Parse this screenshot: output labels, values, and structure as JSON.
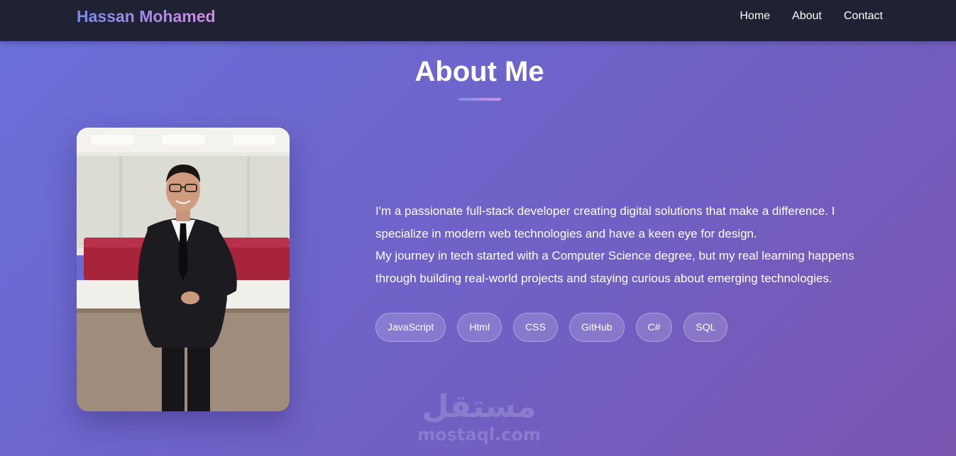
{
  "nav": {
    "brand": "Hassan Mohamed",
    "links": [
      "Home",
      "About",
      "Contact"
    ]
  },
  "about": {
    "title": "About Me",
    "bio": [
      "I'm a passionate full-stack developer creating digital solutions that make a difference. I specialize in modern web technologies and have a keen eye for design.",
      "My journey in tech started with a Computer Science degree, but my real learning happens through building real-world projects and staying curious about emerging technologies."
    ],
    "skills": [
      "JavaScript",
      "Html",
      "CSS",
      "GitHub",
      "C#",
      "SQL"
    ]
  },
  "watermark": {
    "arabic": "مستقل",
    "latin": "mostaql.com"
  },
  "colors": {
    "navbar": "#1e2233",
    "gradient_start": "#6a70d9",
    "gradient_end": "#7a55b0",
    "brand_gradient_start": "#7b8ce8",
    "brand_gradient_end": "#d58ce0"
  }
}
